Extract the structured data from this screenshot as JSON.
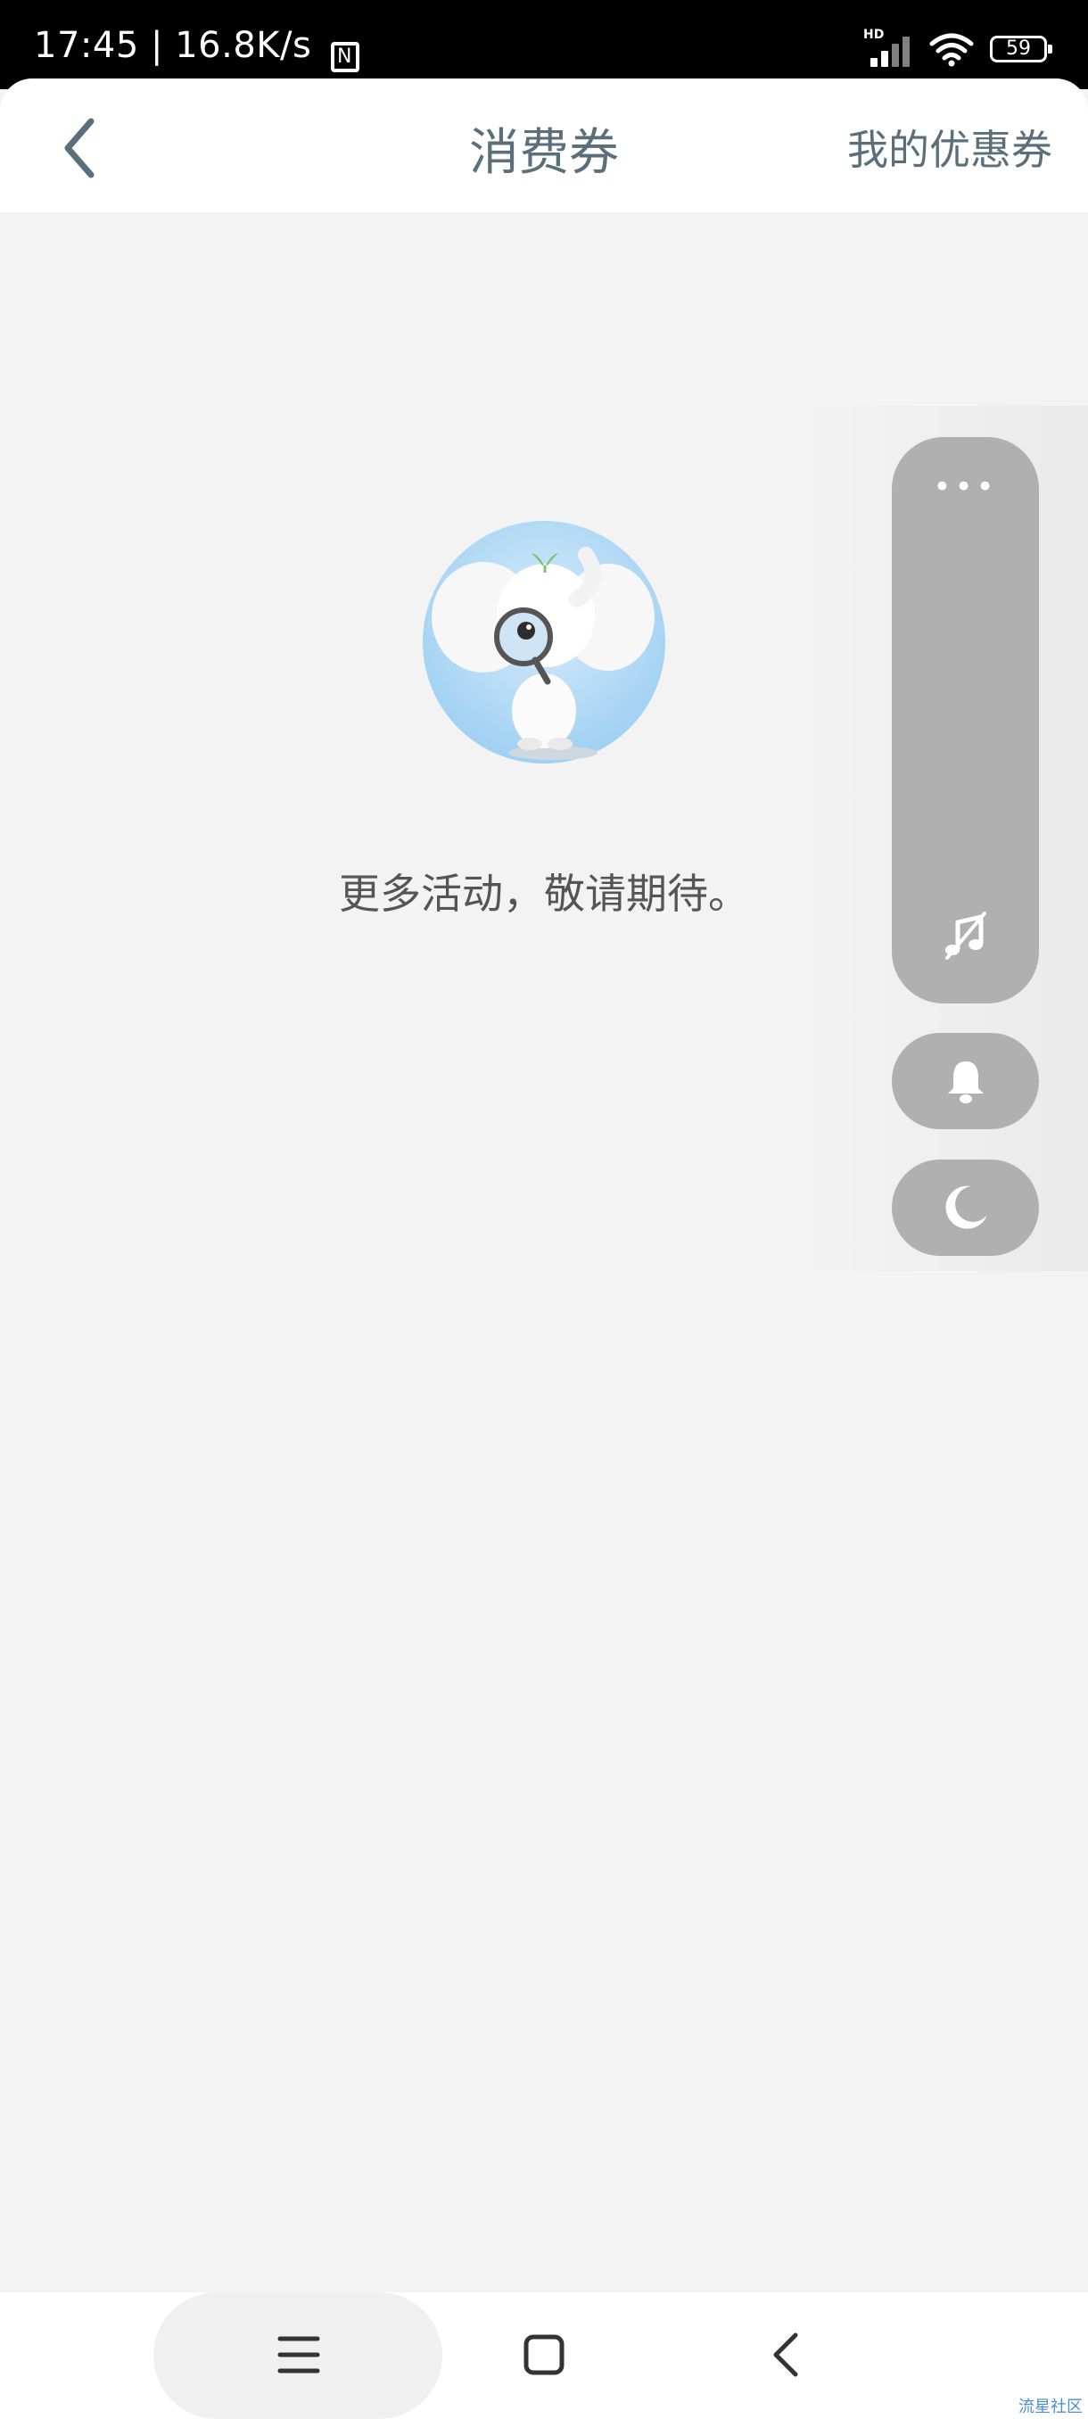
{
  "status_bar": {
    "time": "17:45",
    "separator": "|",
    "speed": "16.8K/s",
    "nfc": "N",
    "network": "HD",
    "battery": "59"
  },
  "header": {
    "title": "消费券",
    "my_coupons": "我的优惠券"
  },
  "empty_state": {
    "message": "更多活动，敬请期待。"
  },
  "floating_panel": {
    "more_label": "•••"
  },
  "watermark": "流星社区",
  "colors": {
    "page_bg": "#f3f3f3",
    "header_text": "#5a6e7c",
    "float_bg": "#b0b0b0"
  }
}
